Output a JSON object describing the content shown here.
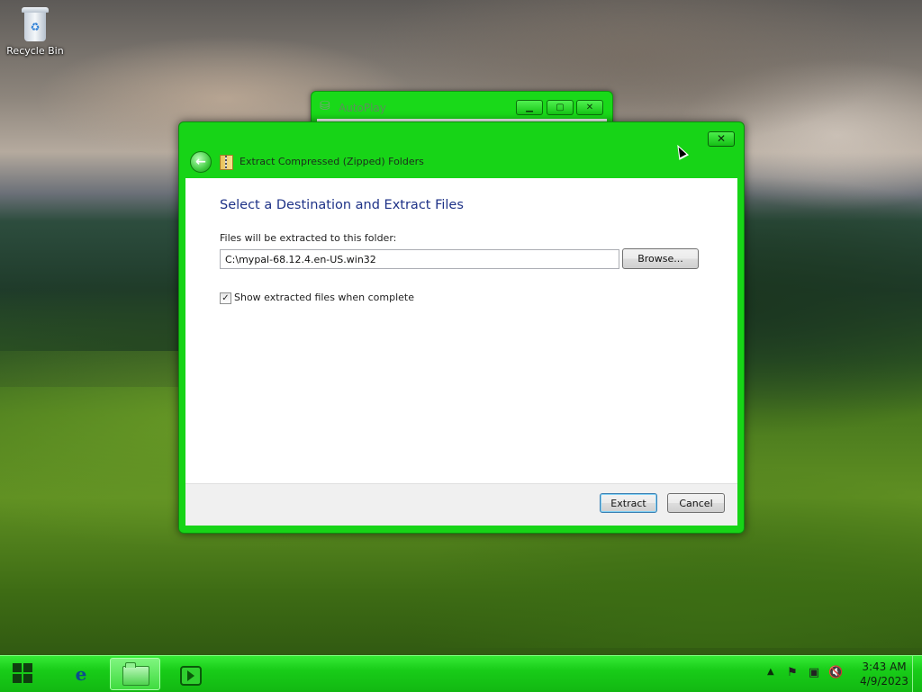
{
  "desktop": {
    "icons": [
      {
        "label": "Recycle Bin",
        "icon": "recycle-bin-icon"
      }
    ]
  },
  "autoplay_window": {
    "title": "AutoPlay",
    "buttons": {
      "minimize": "minimize-icon",
      "maximize": "maximize-icon",
      "close": "close-icon"
    }
  },
  "dialog": {
    "title": "Extract Compressed (Zipped) Folders",
    "close_label": "✕",
    "heading": "Select a Destination and Extract Files",
    "dest_label": "Files will be extracted to this folder:",
    "path_value": "C:\\mypal-68.12.4.en-US.win32",
    "browse_label": "Browse...",
    "show_files_checked": true,
    "show_files_label": "Show extracted files when complete",
    "extract_label": "Extract",
    "cancel_label": "Cancel"
  },
  "taskbar": {
    "pinned": [
      {
        "name": "Internet Explorer",
        "icon": "internet-explorer-icon"
      },
      {
        "name": "Windows Explorer",
        "icon": "folder-icon",
        "active": true
      },
      {
        "name": "Windows Media Player",
        "icon": "media-player-icon"
      }
    ],
    "tray": {
      "icons": [
        "action-center-flag-icon",
        "network-icon",
        "volume-muted-icon"
      ],
      "time": "3:43 AM",
      "date": "4/9/2023"
    }
  },
  "colors": {
    "window_chrome": "#17d417",
    "taskbar": "#18cc18",
    "heading_text": "#1e3287"
  }
}
